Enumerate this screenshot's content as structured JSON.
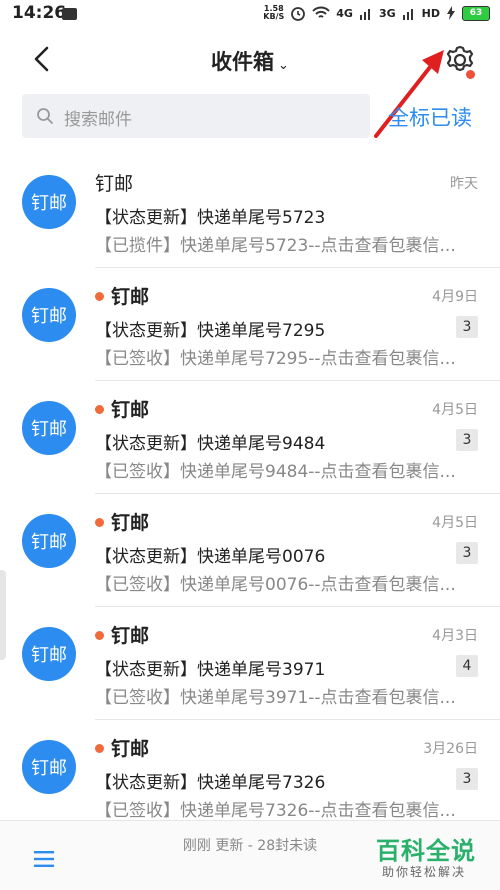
{
  "status_bar": {
    "time": "14:26",
    "speed_value": "1.58",
    "speed_unit": "KB/S",
    "net1": "4G",
    "net2": "3G",
    "hd": "HD",
    "battery": "63"
  },
  "header": {
    "title": "收件箱",
    "title_chevron": "⌄"
  },
  "search": {
    "placeholder": "搜索邮件",
    "mark_all_read": "全标已读"
  },
  "colors": {
    "accent": "#2d8cf0",
    "unread_dot": "#f06a3a",
    "annotation_arrow": "#e02020",
    "watermark": "#29b16b"
  },
  "messages": [
    {
      "sender": "钉邮",
      "avatar_text": "钉邮",
      "unread": false,
      "date": "昨天",
      "subject": "【状态更新】快递单尾号5723",
      "preview": "【已揽件】快递单尾号5723--点击查看包裹信...",
      "count": ""
    },
    {
      "sender": "钉邮",
      "avatar_text": "钉邮",
      "unread": true,
      "date": "4月9日",
      "subject": "【状态更新】快递单尾号7295",
      "preview": "【已签收】快递单尾号7295--点击查看包裹信...",
      "count": "3"
    },
    {
      "sender": "钉邮",
      "avatar_text": "钉邮",
      "unread": true,
      "date": "4月5日",
      "subject": "【状态更新】快递单尾号9484",
      "preview": "【已签收】快递单尾号9484--点击查看包裹信...",
      "count": "3"
    },
    {
      "sender": "钉邮",
      "avatar_text": "钉邮",
      "unread": true,
      "date": "4月5日",
      "subject": "【状态更新】快递单尾号0076",
      "preview": "【已签收】快递单尾号0076--点击查看包裹信...",
      "count": "3"
    },
    {
      "sender": "钉邮",
      "avatar_text": "钉邮",
      "unread": true,
      "date": "4月3日",
      "subject": "【状态更新】快递单尾号3971",
      "preview": "【已签收】快递单尾号3971--点击查看包裹信...",
      "count": "4"
    },
    {
      "sender": "钉邮",
      "avatar_text": "钉邮",
      "unread": true,
      "date": "3月26日",
      "subject": "【状态更新】快递单尾号7326",
      "preview": "【已签收】快递单尾号7326--点击查看包裹信...",
      "count": "3"
    }
  ],
  "bottom": {
    "status": "刚刚 更新 - 28封未读"
  },
  "watermark": {
    "title": "百科全说",
    "subtitle": "助你轻松解决"
  }
}
